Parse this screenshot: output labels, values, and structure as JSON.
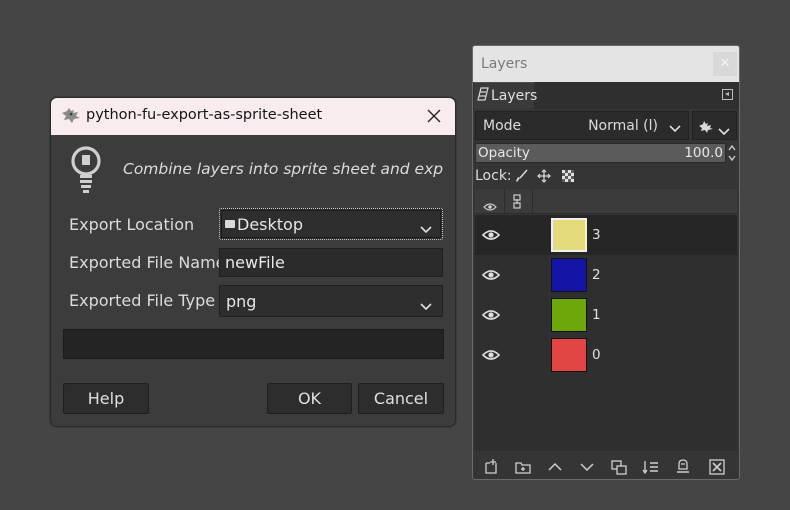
{
  "export_dialog": {
    "title": "python-fu-export-as-sprite-sheet",
    "description": "Combine layers into sprite sheet and export",
    "export_location": {
      "label": "Export Location",
      "value": "Desktop"
    },
    "file_name": {
      "label": "Exported File Name",
      "value": "newFile"
    },
    "file_type": {
      "label": "Exported File Type",
      "value": "png"
    },
    "buttons": {
      "help": "Help",
      "ok": "OK",
      "cancel": "Cancel"
    }
  },
  "layers_dock": {
    "title": "Layers",
    "tab_label": "Layers",
    "close_glyph": "✕",
    "mode": {
      "label": "Mode",
      "value": "Normal (l)"
    },
    "opacity": {
      "label": "Opacity",
      "value": "100.0"
    },
    "lock_label": "Lock:",
    "layers": [
      {
        "name": "3",
        "color": "#e5da7a",
        "visible": true,
        "selected": true
      },
      {
        "name": "2",
        "color": "#1414a6",
        "visible": true,
        "selected": false
      },
      {
        "name": "1",
        "color": "#6ea70a",
        "visible": true,
        "selected": false
      },
      {
        "name": "0",
        "color": "#e34545",
        "visible": true,
        "selected": false
      }
    ]
  },
  "colors": {
    "desktop": "#454545",
    "dialog_bg": "#3c3c3c",
    "dialog_titlebar": "#f9ecef",
    "dock_titlebar": "#e4e4e4"
  }
}
